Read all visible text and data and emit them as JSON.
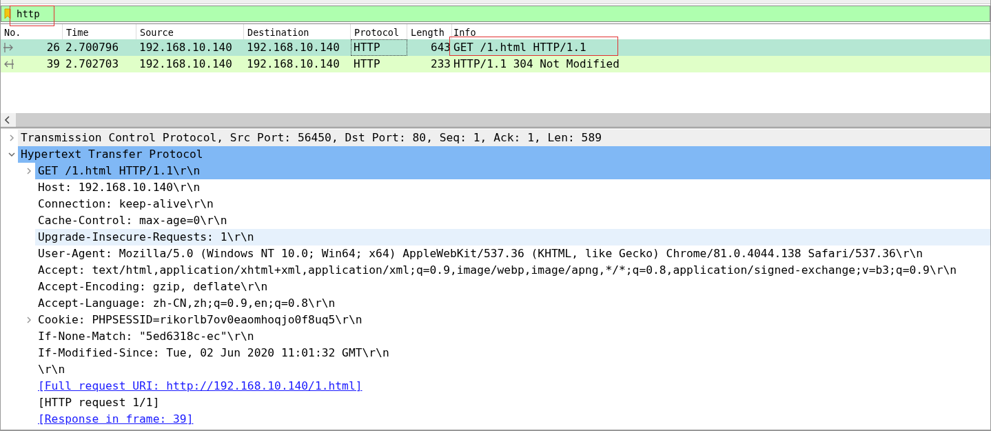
{
  "filter": {
    "value": "http",
    "highlighted": true
  },
  "packet_list": {
    "columns": [
      "No.",
      "Time",
      "Source",
      "Destination",
      "Protocol",
      "Length",
      "Info"
    ],
    "rows": [
      {
        "no": "26",
        "time": "2.700796",
        "source": "192.168.10.140",
        "destination": "192.168.10.140",
        "protocol": "HTTP",
        "length": "643",
        "info": "GET /1.html HTTP/1.1",
        "selected": true,
        "outgoing": true,
        "focused_protocol": true,
        "info_highlighted": true
      },
      {
        "no": "39",
        "time": "2.702703",
        "source": "192.168.10.140",
        "destination": "192.168.10.140",
        "protocol": "HTTP",
        "length": "233",
        "info": "HTTP/1.1 304 Not Modified",
        "selected": false,
        "outgoing": false,
        "focused_protocol": false,
        "info_highlighted": false
      }
    ]
  },
  "details": [
    {
      "text": "Transmission Control Protocol, Src Port: 56450, Dst Port: 80, Seq: 1, Ack: 1, Len: 589",
      "expanded": false,
      "selected": false,
      "hovered": false,
      "shaded": true
    },
    {
      "text": "Hypertext Transfer Protocol",
      "expanded": true,
      "selected": true,
      "hovered": false,
      "shaded": false,
      "children": [
        {
          "text": "GET /1.html HTTP/1.1\\r\\n",
          "expanded": false,
          "selected": true,
          "hovered": false,
          "shaded": false
        },
        {
          "text": "Host: 192.168.10.140\\r\\n",
          "selected": false,
          "hovered": false,
          "shaded": false
        },
        {
          "text": "Connection: keep-alive\\r\\n",
          "selected": false,
          "hovered": false,
          "shaded": false
        },
        {
          "text": "Cache-Control: max-age=0\\r\\n",
          "selected": false,
          "hovered": false,
          "shaded": false
        },
        {
          "text": "Upgrade-Insecure-Requests: 1\\r\\n",
          "selected": false,
          "hovered": true,
          "shaded": false
        },
        {
          "text": "User-Agent: Mozilla/5.0 (Windows NT 10.0; Win64; x64) AppleWebKit/537.36 (KHTML, like Gecko) Chrome/81.0.4044.138 Safari/537.36\\r\\n",
          "selected": false,
          "hovered": false,
          "shaded": false
        },
        {
          "text": "Accept: text/html,application/xhtml+xml,application/xml;q=0.9,image/webp,image/apng,*/*;q=0.8,application/signed-exchange;v=b3;q=0.9\\r\\n",
          "selected": false,
          "hovered": false,
          "shaded": false
        },
        {
          "text": "Accept-Encoding: gzip, deflate\\r\\n",
          "selected": false,
          "hovered": false,
          "shaded": false
        },
        {
          "text": "Accept-Language: zh-CN,zh;q=0.9,en;q=0.8\\r\\n",
          "selected": false,
          "hovered": false,
          "shaded": false
        },
        {
          "text": "Cookie: PHPSESSID=rikorlb7ov0eaomhoqjo0f8uq5\\r\\n",
          "expanded": false,
          "selected": false,
          "hovered": false,
          "shaded": false
        },
        {
          "text": "If-None-Match: \"5ed6318c-ec\"\\r\\n",
          "selected": false,
          "hovered": false,
          "shaded": false
        },
        {
          "text": "If-Modified-Since: Tue, 02 Jun 2020 11:01:32 GMT\\r\\n",
          "selected": false,
          "hovered": false,
          "shaded": false
        },
        {
          "text": "\\r\\n",
          "selected": false,
          "hovered": false,
          "shaded": false
        },
        {
          "text": "[Full request URI: http://192.168.10.140/1.html]",
          "kind": "link",
          "selected": false,
          "hovered": false,
          "shaded": false
        },
        {
          "text": "[HTTP request 1/1]",
          "selected": false,
          "hovered": false,
          "shaded": false
        },
        {
          "text": "[Response in frame: 39]",
          "kind": "link",
          "selected": false,
          "hovered": false,
          "shaded": false
        }
      ]
    }
  ]
}
